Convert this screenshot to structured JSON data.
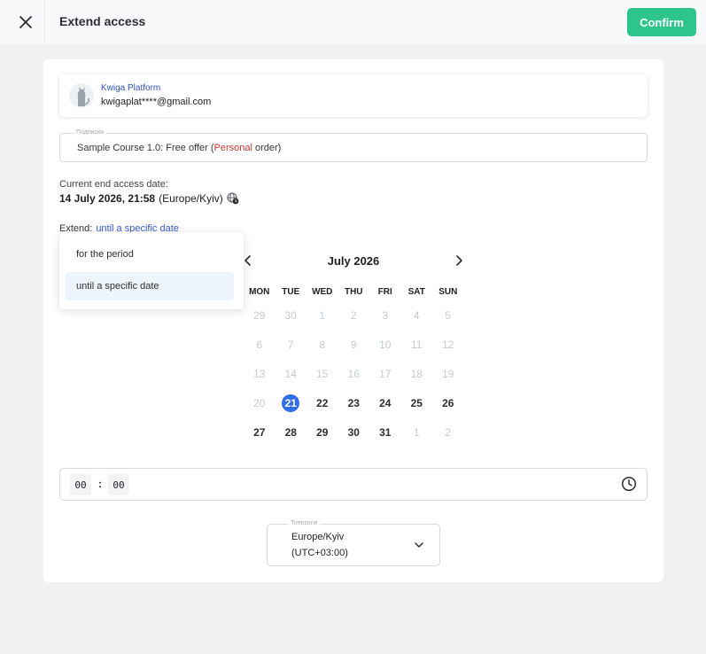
{
  "header": {
    "title": "Extend access",
    "confirm_label": "Confirm"
  },
  "platform": {
    "name": "Kwiga Platform",
    "email": "kwigaplat****@gmail.com"
  },
  "subscription": {
    "legend": "Подписки",
    "course": "Sample Course 1.0: Free offer ",
    "open_paren": "(",
    "order_type": "Personal",
    "order_suffix": " order)"
  },
  "current": {
    "label": "Current end access date:",
    "date": "14 July 2026, 21:58",
    "tz": "(Europe/Kyiv)"
  },
  "extend": {
    "label": "Extend:",
    "mode": "until a specific date",
    "options": [
      "for the period",
      "until a specific date"
    ],
    "selected_option": "until a specific date"
  },
  "calendar": {
    "month": "July 2026",
    "weekdays": [
      "MON",
      "TUE",
      "WED",
      "THU",
      "FRI",
      "SAT",
      "SUN"
    ],
    "selected_day": "21",
    "weeks": [
      [
        {
          "d": "29",
          "s": "muted"
        },
        {
          "d": "30",
          "s": "muted"
        },
        {
          "d": "1",
          "s": "muted"
        },
        {
          "d": "2",
          "s": "muted"
        },
        {
          "d": "3",
          "s": "muted"
        },
        {
          "d": "4",
          "s": "muted"
        },
        {
          "d": "5",
          "s": "muted"
        }
      ],
      [
        {
          "d": "6",
          "s": "muted"
        },
        {
          "d": "7",
          "s": "muted"
        },
        {
          "d": "8",
          "s": "muted"
        },
        {
          "d": "9",
          "s": "muted"
        },
        {
          "d": "10",
          "s": "muted"
        },
        {
          "d": "11",
          "s": "muted"
        },
        {
          "d": "12",
          "s": "muted"
        }
      ],
      [
        {
          "d": "13",
          "s": "muted"
        },
        {
          "d": "14",
          "s": "muted"
        },
        {
          "d": "15",
          "s": "muted"
        },
        {
          "d": "16",
          "s": "muted"
        },
        {
          "d": "17",
          "s": "muted"
        },
        {
          "d": "18",
          "s": "muted"
        },
        {
          "d": "19",
          "s": "muted"
        }
      ],
      [
        {
          "d": "20",
          "s": "muted"
        },
        {
          "d": "21",
          "s": "today"
        },
        {
          "d": "22",
          "s": "avail"
        },
        {
          "d": "23",
          "s": "avail"
        },
        {
          "d": "24",
          "s": "avail"
        },
        {
          "d": "25",
          "s": "avail"
        },
        {
          "d": "26",
          "s": "avail"
        }
      ],
      [
        {
          "d": "27",
          "s": "avail"
        },
        {
          "d": "28",
          "s": "avail"
        },
        {
          "d": "29",
          "s": "avail"
        },
        {
          "d": "30",
          "s": "avail"
        },
        {
          "d": "31",
          "s": "avail"
        },
        {
          "d": "1",
          "s": "muted"
        },
        {
          "d": "2",
          "s": "muted"
        }
      ]
    ]
  },
  "time": {
    "hours": "00",
    "separator": ":",
    "minutes": "00"
  },
  "timezone": {
    "legend": "Timezone",
    "name": "Europe/Kyiv",
    "offset": "(UTC+03:00)"
  },
  "icons": {
    "close": "close-icon",
    "globe_clock": "globe-clock-icon",
    "prev": "chevron-left-icon",
    "next": "chevron-right-icon",
    "clock": "clock-icon",
    "dropdown": "chevron-down-icon"
  },
  "colors": {
    "confirm_bg": "#2dc58c",
    "link": "#3a5ccc",
    "personal": "#c73a2e",
    "selected_day": "#2f6ee6"
  }
}
